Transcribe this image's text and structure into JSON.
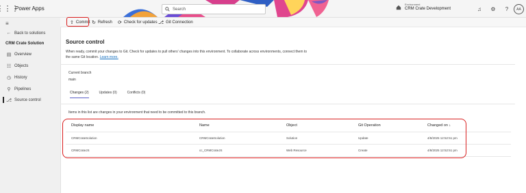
{
  "app": {
    "name": "Power Apps"
  },
  "search": {
    "placeholder": "Search"
  },
  "environment": {
    "label": "Environment",
    "name": "CRM Crate Development"
  },
  "user": {
    "initials": "AA"
  },
  "nav": {
    "back": "Back to solutions",
    "solution": "CRM Crate Solution",
    "items": [
      {
        "label": "Overview",
        "icon": "overview-icon"
      },
      {
        "label": "Objects",
        "icon": "objects-icon"
      },
      {
        "label": "History",
        "icon": "history-icon"
      },
      {
        "label": "Pipelines",
        "icon": "pipelines-icon"
      },
      {
        "label": "Source control",
        "icon": "source-control-icon"
      }
    ]
  },
  "commands": {
    "commit": "Commit",
    "refresh": "Refresh",
    "check": "Check for updates",
    "git": "Git Connection"
  },
  "page": {
    "title": "Source control",
    "description_line1": "When ready, commit your changes to Git. Check for updates to pull others' changes into this environment. To collaborate across environments, connect them to",
    "description_line2": "the same Git location.",
    "learn_more": "Learn more.",
    "branch_label": "Current branch",
    "branch_value": "main",
    "tabs": [
      "Changes (2)",
      "Updates (0)",
      "Conflicts (0)"
    ],
    "list_info": "Items in this list are changes in your environment that need to be committed to this branch."
  },
  "table": {
    "headers": [
      "Display name",
      "Name",
      "Object",
      "Git Operation",
      "Changed on ↓"
    ],
    "rows": [
      [
        "CRMCrateSolution",
        "CRMCrateSolution",
        "Solution",
        "Update",
        "4/8/2025 12:52:51 pm"
      ],
      [
        "CRMCrateJS",
        "cc_CRMCrateJS",
        "Web Resource",
        "Create",
        "4/8/2025 12:52:51 pm"
      ]
    ]
  }
}
